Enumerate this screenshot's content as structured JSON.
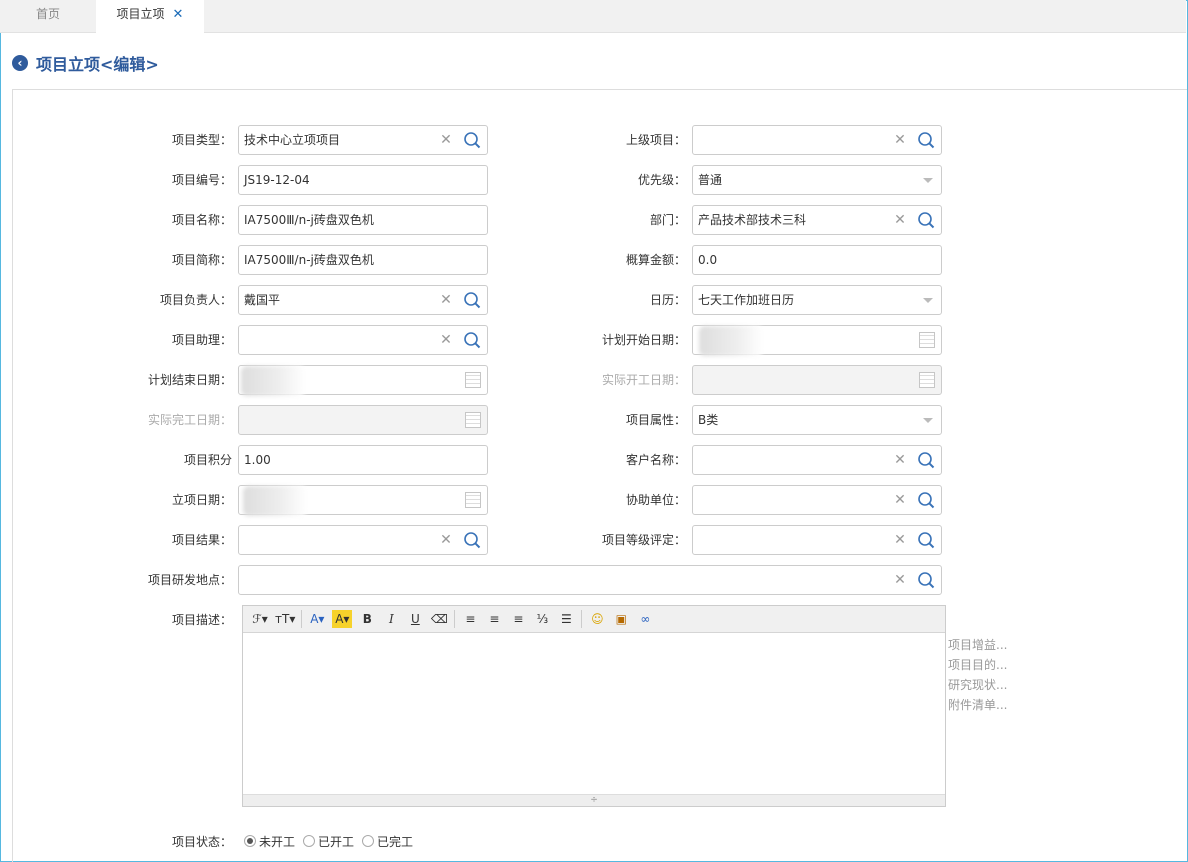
{
  "tabs": {
    "home": "首页",
    "active": "项目立项",
    "close": "✕"
  },
  "page": {
    "title": "项目立项<编辑>"
  },
  "form": {
    "project_type": {
      "label": "项目类型：",
      "value": "技术中心立项项目"
    },
    "parent_project": {
      "label": "上级项目：",
      "value": ""
    },
    "project_no": {
      "label": "项目编号：",
      "value": "JS19-12-04"
    },
    "priority": {
      "label": "优先级：",
      "value": "普通"
    },
    "project_name": {
      "label": "项目名称：",
      "value": "IA7500Ⅲ/n-j砖盘双色机"
    },
    "department": {
      "label": "部门：",
      "value": "产品技术部技术三科"
    },
    "short_name": {
      "label": "项目简称：",
      "value": "IA7500Ⅲ/n-j砖盘双色机"
    },
    "budget": {
      "label": "概算金额：",
      "value": "0.0"
    },
    "leader": {
      "label": "项目负责人：",
      "value": "戴国平"
    },
    "calendar": {
      "label": "日历：",
      "value": "七天工作加班日历"
    },
    "assistant": {
      "label": "项目助理：",
      "value": ""
    },
    "plan_start": {
      "label": "计划开始日期：",
      "value": ""
    },
    "plan_end": {
      "label": "计划结束日期：",
      "value": ""
    },
    "actual_start": {
      "label": "实际开工日期：",
      "value": ""
    },
    "actual_finish": {
      "label": "实际完工日期：",
      "value": ""
    },
    "attribute": {
      "label": "项目属性：",
      "value": "B类"
    },
    "points": {
      "label": "项目积分",
      "value": "1.00"
    },
    "customer": {
      "label": "客户名称：",
      "value": ""
    },
    "setup_date": {
      "label": "立项日期：",
      "value": ""
    },
    "assist_unit": {
      "label": "协助单位：",
      "value": ""
    },
    "result": {
      "label": "项目结果：",
      "value": ""
    },
    "grade": {
      "label": "项目等级评定：",
      "value": ""
    },
    "location": {
      "label": "项目研发地点：",
      "value": ""
    },
    "description": {
      "label": "项目描述："
    },
    "status": {
      "label": "项目状态：",
      "options": [
        "未开工",
        "已开工",
        "已完工"
      ],
      "selected": "未开工"
    }
  },
  "editor": {
    "toolbar": {
      "font": "ℱ▾",
      "size": "тT▾",
      "color": "A▾",
      "bg": "A▾",
      "bold": "B",
      "italic": "I",
      "underline": "U",
      "eraser": "⌫",
      "align_left": "≡",
      "align_center": "≡",
      "align_right": "≡",
      "ordered": "⅓",
      "unordered": "☰",
      "emoji": "☺",
      "image": "▣",
      "link": "∞"
    },
    "resize_handle": "÷"
  },
  "hints": [
    "项目增益...",
    "项目目的...",
    "研究现状...",
    "附件清单..."
  ],
  "colors": {
    "accent": "#2f5b9c",
    "frame": "#56b8e0",
    "tab_close": "#1a6bb8"
  }
}
